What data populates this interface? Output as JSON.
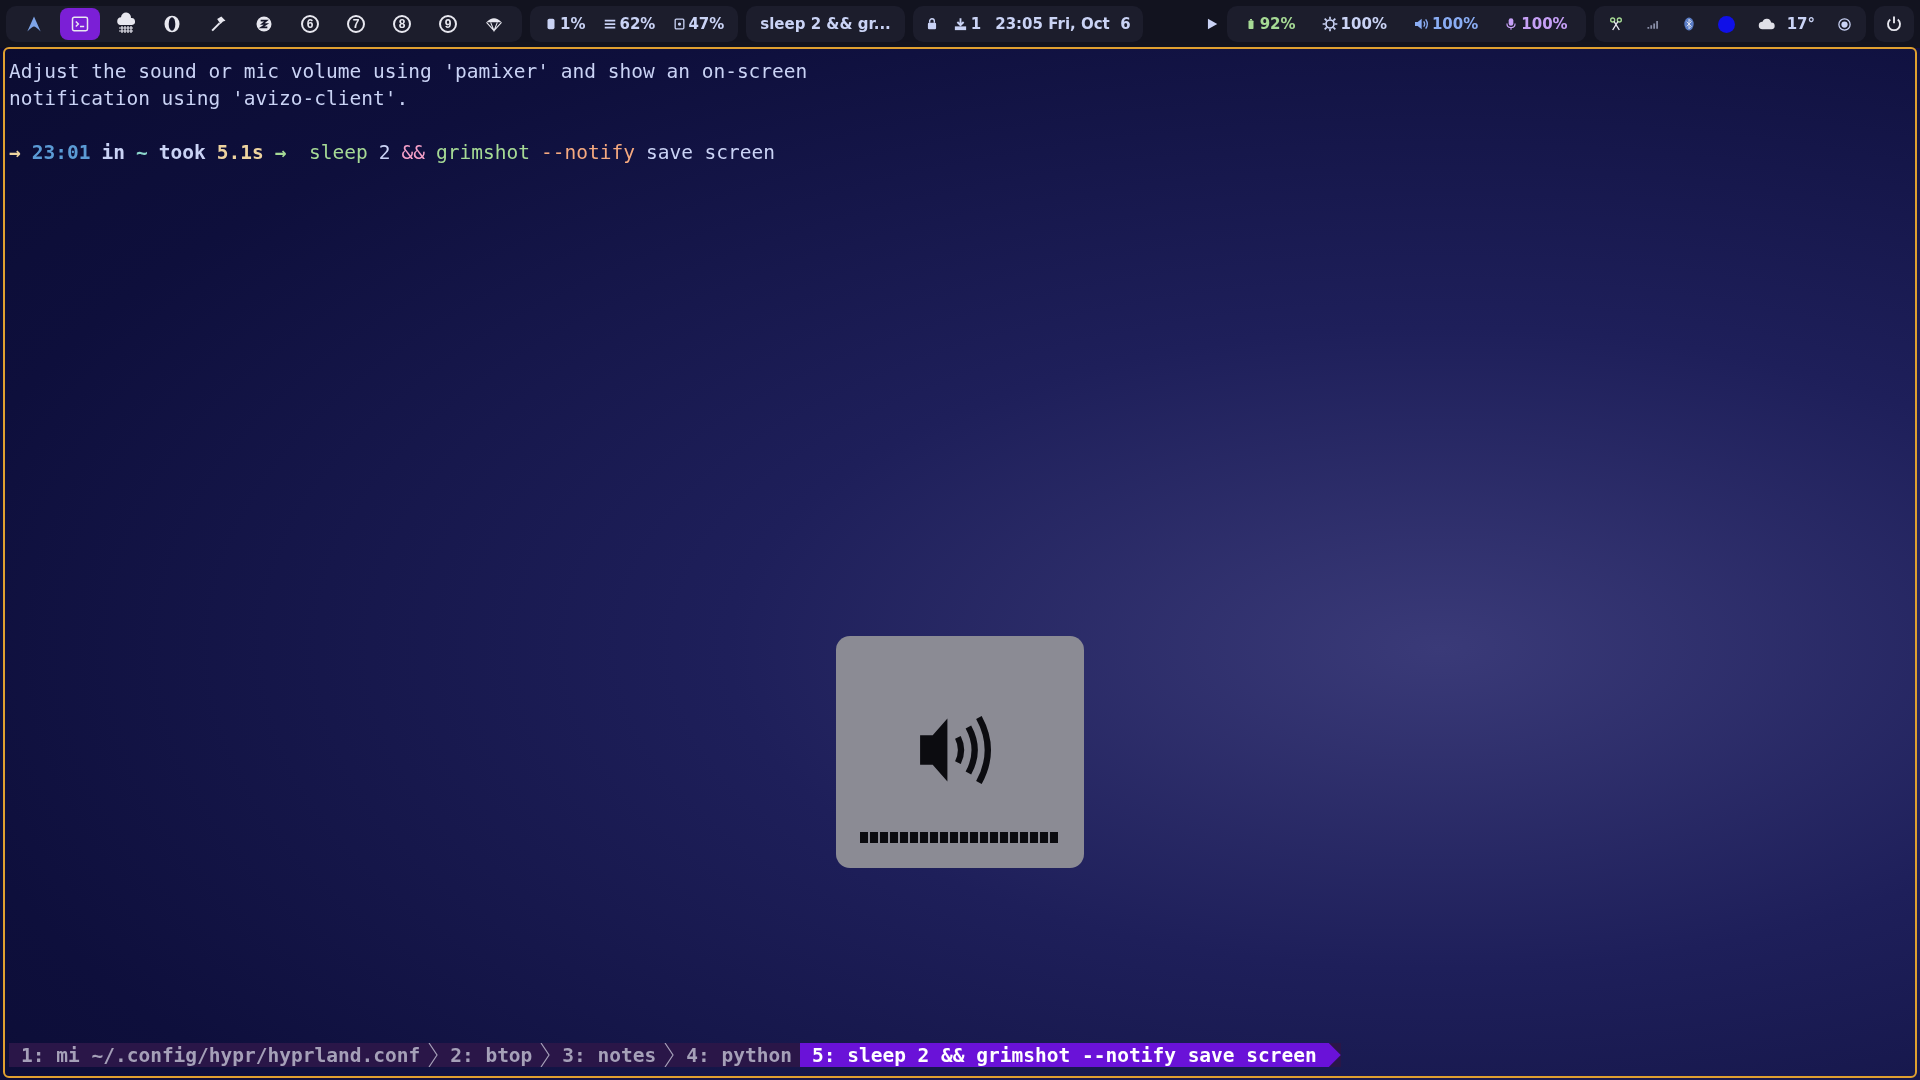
{
  "top_bar": {
    "workspaces": [
      {
        "kind": "arch",
        "selected": false
      },
      {
        "kind": "terminal",
        "selected": true
      },
      {
        "kind": "rain",
        "selected": false
      },
      {
        "kind": "ring",
        "selected": false
      },
      {
        "kind": "hammer",
        "selected": false
      },
      {
        "kind": "swirl",
        "selected": false
      },
      {
        "kind": "number",
        "label": "6",
        "selected": false
      },
      {
        "kind": "number",
        "label": "7",
        "selected": false
      },
      {
        "kind": "number",
        "label": "8",
        "selected": false
      },
      {
        "kind": "number",
        "label": "9",
        "selected": false
      },
      {
        "kind": "parachute",
        "selected": false
      }
    ],
    "stats": [
      {
        "kind": "cpu",
        "value": "1%"
      },
      {
        "kind": "memory",
        "value": "62%"
      },
      {
        "kind": "disk",
        "value": "47%"
      }
    ],
    "window_title": "sleep 2 && gr...",
    "center": {
      "updates": "1",
      "clock": "23:05 Fri, Oct  6"
    },
    "levels": [
      {
        "kind": "battery",
        "value": "92%",
        "color": "#a6da95"
      },
      {
        "kind": "brightness",
        "value": "100%",
        "color": "#cad3f5"
      },
      {
        "kind": "volume",
        "value": "100%",
        "color": "#8aadf4"
      },
      {
        "kind": "mic",
        "value": "100%",
        "color": "#c6a0f6"
      }
    ],
    "tray": {
      "weather": "17°"
    }
  },
  "terminal": {
    "description": [
      "Adjust the sound or mic volume using 'pamixer' and show an on-screen",
      "notification using 'avizo-client'."
    ],
    "prompt": [
      {
        "text": "→",
        "color": "#eed49f",
        "bold": true
      },
      {
        "text": "23:01",
        "color": "#5b9bd5",
        "bold": true
      },
      {
        "text": "in",
        "color": "#cad3f5",
        "bold": true
      },
      {
        "text": "~",
        "color": "#8bd5ca",
        "bold": true
      },
      {
        "text": "took",
        "color": "#cad3f5",
        "bold": true
      },
      {
        "text": "5.1s",
        "color": "#eed49f",
        "bold": true
      },
      {
        "text": "→",
        "color": "#a6da95",
        "bold": true
      },
      {
        "text": " sleep",
        "color": "#a6da95",
        "bold": false
      },
      {
        "text": "2",
        "color": "#cad3f5",
        "bold": false
      },
      {
        "text": "&&",
        "color": "#f5a0c8",
        "bold": false
      },
      {
        "text": "grimshot",
        "color": "#a6da95",
        "bold": false
      },
      {
        "text": "--notify",
        "color": "#f5a97f",
        "bold": false
      },
      {
        "text": "save screen",
        "color": "#cad3f5",
        "bold": false
      }
    ]
  },
  "tmux_tabs": [
    {
      "label": "1: mi ~/.config/hypr/hyprland.conf",
      "selected": false
    },
    {
      "label": "2: btop",
      "selected": false
    },
    {
      "label": "3: notes",
      "selected": false
    },
    {
      "label": "4: python",
      "selected": false
    },
    {
      "label": "5: sleep 2 && grimshot --notify save screen",
      "selected": true
    }
  ],
  "osd": {
    "level": 1
  }
}
